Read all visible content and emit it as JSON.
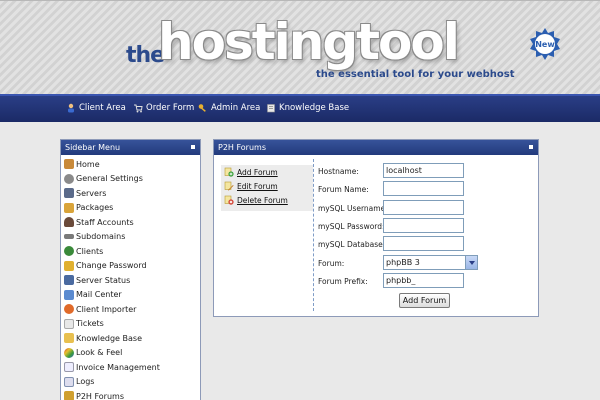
{
  "header": {
    "logo_the": "the",
    "logo_main": "hostingtool",
    "tagline": "the essential tool for your webhost",
    "badge": "New"
  },
  "nav": [
    {
      "label": "Client Area",
      "icon": "user-icon"
    },
    {
      "label": "Order Form",
      "icon": "cart-icon"
    },
    {
      "label": "Admin Area",
      "icon": "key-icon"
    },
    {
      "label": "Knowledge Base",
      "icon": "book-icon"
    }
  ],
  "sidebar": {
    "title": "Sidebar Menu",
    "items": [
      {
        "label": "Home",
        "icon": "home-icon",
        "color": "#c98a3a"
      },
      {
        "label": "General Settings",
        "icon": "settings-icon",
        "color": "#8a8a8a"
      },
      {
        "label": "Servers",
        "icon": "server-icon",
        "color": "#5a6a8a"
      },
      {
        "label": "Packages",
        "icon": "package-icon",
        "color": "#d9a43a"
      },
      {
        "label": "Staff Accounts",
        "icon": "staff-icon",
        "color": "#6a4a3a"
      },
      {
        "label": "Subdomains",
        "icon": "subdomain-icon",
        "color": "#7a7a7a"
      },
      {
        "label": "Clients",
        "icon": "clients-icon",
        "color": "#3a8a3a"
      },
      {
        "label": "Change Password",
        "icon": "lock-icon",
        "color": "#e0b030"
      },
      {
        "label": "Server Status",
        "icon": "monitor-icon",
        "color": "#4a6aa0"
      },
      {
        "label": "Mail Center",
        "icon": "mail-icon",
        "color": "#5a8ad0"
      },
      {
        "label": "Client Importer",
        "icon": "importer-icon",
        "color": "#e06a2a"
      },
      {
        "label": "Tickets",
        "icon": "ticket-icon",
        "color": "#b8b8b8"
      },
      {
        "label": "Knowledge Base",
        "icon": "folder-icon",
        "color": "#e8c050"
      },
      {
        "label": "Look & Feel",
        "icon": "palette-icon",
        "color": "#d0402a"
      },
      {
        "label": "Invoice Management",
        "icon": "invoice-icon",
        "color": "#a0a0c0"
      },
      {
        "label": "Logs",
        "icon": "logs-icon",
        "color": "#8090b0"
      },
      {
        "label": "P2H Forums",
        "icon": "forum-icon",
        "color": "#d0a030"
      }
    ]
  },
  "main": {
    "title": "P2H Forums",
    "actions": [
      {
        "label": "Add Forum",
        "icon": "add-icon"
      },
      {
        "label": "Edit Forum",
        "icon": "edit-icon"
      },
      {
        "label": "Delete Forum",
        "icon": "delete-icon"
      }
    ],
    "form": {
      "hostname_label": "Hostname:",
      "hostname_value": "localhost",
      "forum_name_label": "Forum Name:",
      "forum_name_value": "",
      "mysql_username_label": "mySQL Username:",
      "mysql_username_value": "",
      "mysql_password_label": "mySQL Password:",
      "mysql_password_value": "",
      "mysql_database_label": "mySQL Database:",
      "mysql_database_value": "",
      "forum_label": "Forum:",
      "forum_selected": "phpBB 3",
      "forum_prefix_label": "Forum Prefix:",
      "forum_prefix_value": "phpbb_",
      "submit_label": "Add Forum"
    }
  },
  "colors": {
    "nav_bg": "#1b2a66",
    "panel_title_bg": "#223a7c",
    "brand_blue": "#2b4a8c"
  }
}
